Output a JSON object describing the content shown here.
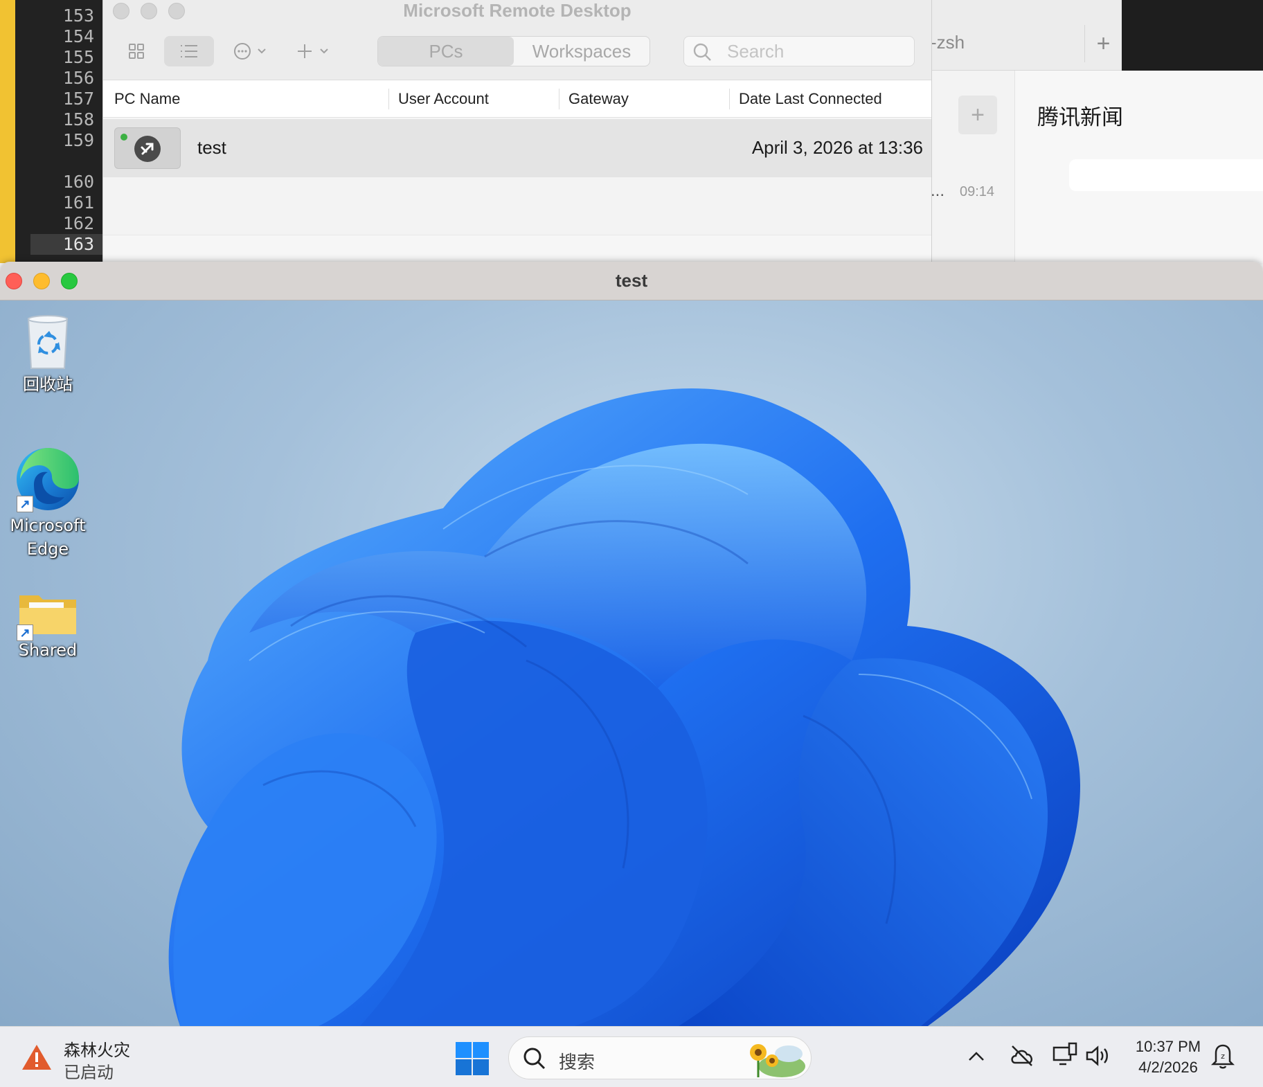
{
  "editor": {
    "line_numbers": [
      "153",
      "154",
      "155",
      "156",
      "157",
      "158",
      "159",
      "160",
      "161",
      "162",
      "163"
    ]
  },
  "terminal": {
    "tab_label": "-zsh",
    "new_tab_label": "+"
  },
  "chat": {
    "add_label": "+",
    "ellipsis": "...",
    "time": "09:14"
  },
  "news": {
    "title": "腾讯新闻"
  },
  "remote_desktop": {
    "window_title": "Microsoft Remote Desktop",
    "tabs": [
      {
        "label": "PCs",
        "active": true
      },
      {
        "label": "Workspaces",
        "active": false
      }
    ],
    "search_placeholder": "Search",
    "columns": [
      "PC Name",
      "User Account",
      "Gateway",
      "Date Last Connected"
    ],
    "rows": [
      {
        "pc_name": "test",
        "user_account": "",
        "gateway": "",
        "date_last_connected": "April 3, 2026 at 13:36",
        "status": "online"
      }
    ]
  },
  "session": {
    "window_title": "test",
    "desktop_icons": [
      {
        "label": "回收站",
        "icon": "recycle-bin-icon"
      },
      {
        "label_line1": "Microsoft",
        "label_line2": "Edge",
        "icon": "edge-icon"
      },
      {
        "label": "Shared",
        "icon": "folder-icon"
      }
    ],
    "taskbar": {
      "notification_title": "森林火灾",
      "notification_subtitle": "已启动",
      "search_placeholder": "搜索",
      "clock_time": "10:37 PM",
      "clock_date": "4/2/2026"
    }
  },
  "colors": {
    "accent_blue": "#1b6fd1",
    "close": "#ff5f57",
    "minimize": "#febc2e",
    "zoom": "#28c840"
  }
}
